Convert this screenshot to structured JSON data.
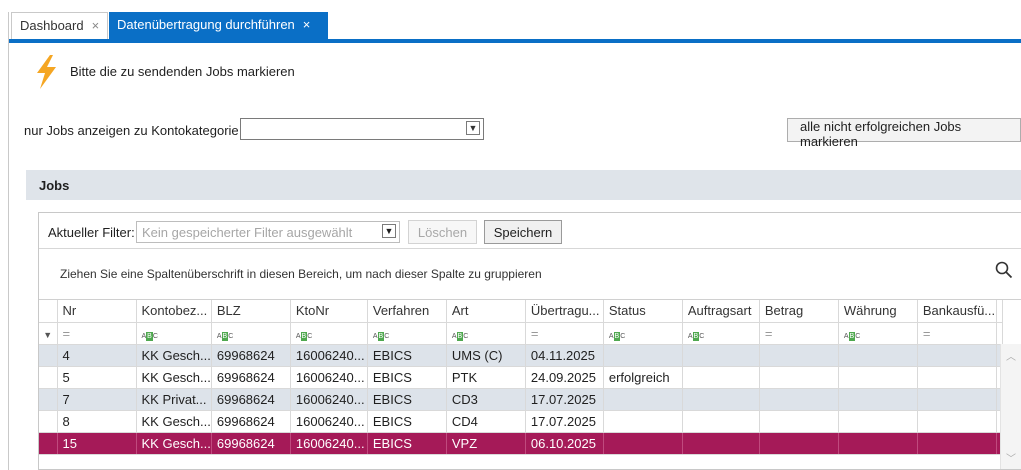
{
  "tabs": [
    {
      "label": "Dashboard",
      "close": "×"
    },
    {
      "label": "Datenübertragung durchführen",
      "close": "×"
    }
  ],
  "instruction": "Bitte die zu sendenden Jobs markieren",
  "kategorie_filter": {
    "label": "nur Jobs anzeigen zu Kontokategorie",
    "value": ""
  },
  "mark_all_button": "alle nicht erfolgreichen Jobs markieren",
  "jobs_section": {
    "title": "Jobs"
  },
  "active_filter": {
    "label": "Aktueller Filter:",
    "placeholder": "Kein gespeicherter Filter ausgewählt",
    "delete_label": "Löschen",
    "save_label": "Speichern"
  },
  "group_hint": "Ziehen Sie eine Spaltenüberschrift in diesen Bereich, um nach dieser Spalte zu gruppieren",
  "grid": {
    "columns": [
      "Nr",
      "Kontobez...",
      "BLZ",
      "KtoNr",
      "Verfahren",
      "Art",
      "Übertragu...",
      "Status",
      "Auftragsart",
      "Betrag",
      "Währung",
      "Bankausfü..."
    ],
    "filter_types": [
      "eq",
      "abc",
      "abc",
      "abc",
      "abc",
      "abc",
      "eq",
      "abc",
      "abc",
      "eq",
      "abc",
      "eq"
    ],
    "rows": [
      {
        "cells": [
          "4",
          "KK Gesch...",
          "69968624",
          "16006240...",
          "EBICS",
          "UMS (C)",
          "04.11.2025",
          "",
          "",
          "",
          "",
          ""
        ],
        "state": "grey"
      },
      {
        "cells": [
          "5",
          "KK Gesch...",
          "69968624",
          "16006240...",
          "EBICS",
          "PTK",
          "24.09.2025",
          "erfolgreich",
          "",
          "",
          "",
          ""
        ],
        "state": "white"
      },
      {
        "cells": [
          "7",
          "KK Privat...",
          "69968624",
          "16006240...",
          "EBICS",
          "CD3",
          "17.07.2025",
          "",
          "",
          "",
          "",
          ""
        ],
        "state": "grey"
      },
      {
        "cells": [
          "8",
          "KK Gesch...",
          "69968624",
          "16006240...",
          "EBICS",
          "CD4",
          "17.07.2025",
          "",
          "",
          "",
          "",
          ""
        ],
        "state": "white"
      },
      {
        "cells": [
          "15",
          "KK Gesch...",
          "69968624",
          "16006240...",
          "EBICS",
          "VPZ",
          "06.10.2025",
          "",
          "",
          "",
          "",
          ""
        ],
        "state": "selected"
      }
    ]
  },
  "colors": {
    "accent": "#0a6fc6",
    "selected_row": "#a51a58",
    "alt_row": "#dde3ea",
    "section_header": "#dfe4ea",
    "bolt": "#f5a623"
  }
}
